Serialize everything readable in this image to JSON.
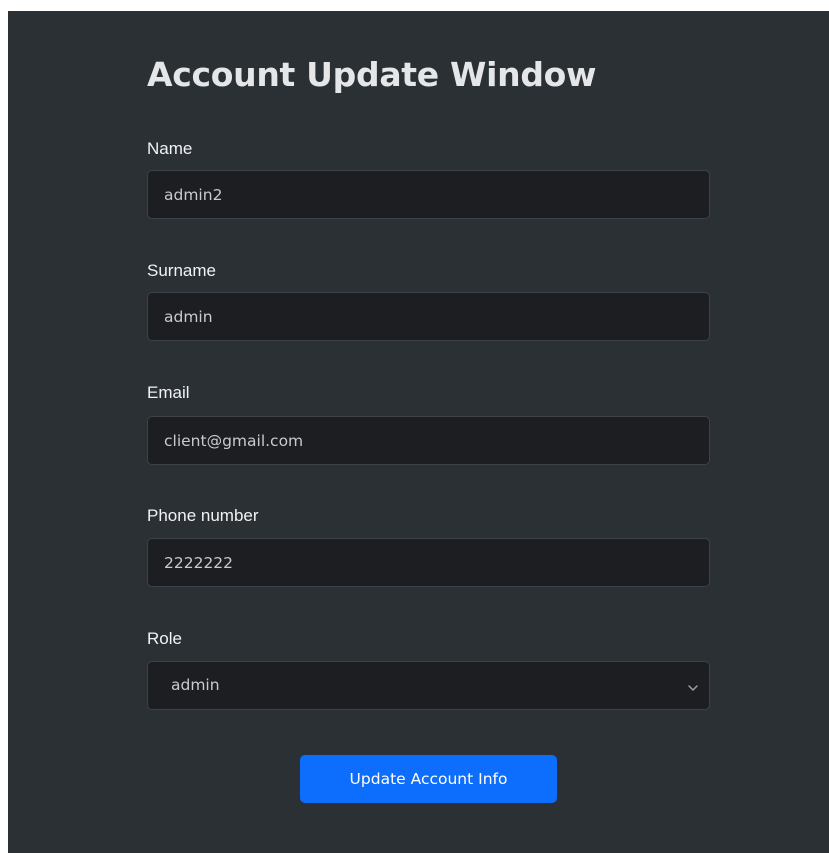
{
  "form": {
    "title": "Account Update Window",
    "fields": {
      "name": {
        "label": "Name",
        "value": "admin2"
      },
      "surname": {
        "label": "Surname",
        "value": "admin"
      },
      "email": {
        "label": "Email",
        "value": "client@gmail.com"
      },
      "phone": {
        "label": "Phone number",
        "value": "2222222"
      },
      "role": {
        "label": "Role",
        "selected": "admin"
      }
    },
    "submit_label": "Update Account Info"
  },
  "colors": {
    "panel_background": "#2b3035",
    "input_background": "#1c1e21",
    "input_border": "#3d4248",
    "primary_button": "#0d6efd"
  },
  "icons": {
    "role_select": "chevron-down-icon"
  }
}
